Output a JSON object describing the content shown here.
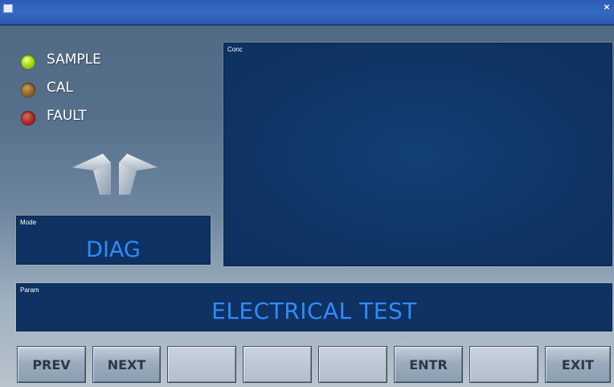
{
  "status_leds": [
    {
      "label": "SAMPLE",
      "state": "on",
      "color": "#b6e81c"
    },
    {
      "label": "CAL",
      "state": "off",
      "color": "#8a6424"
    },
    {
      "label": "FAULT",
      "state": "off",
      "color": "#a52a22"
    }
  ],
  "mode": {
    "label": "Mode",
    "value": "DIAG"
  },
  "conc": {
    "label": "Conc"
  },
  "param": {
    "label": "Param",
    "value": "ELECTRICAL TEST"
  },
  "buttons": [
    "PREV",
    "NEXT",
    "",
    "",
    "",
    "ENTR",
    "",
    "EXIT"
  ],
  "colors": {
    "accent_text": "#2f8cff",
    "panel_bg": "#0f3262",
    "titlebar": "#3568c4"
  }
}
